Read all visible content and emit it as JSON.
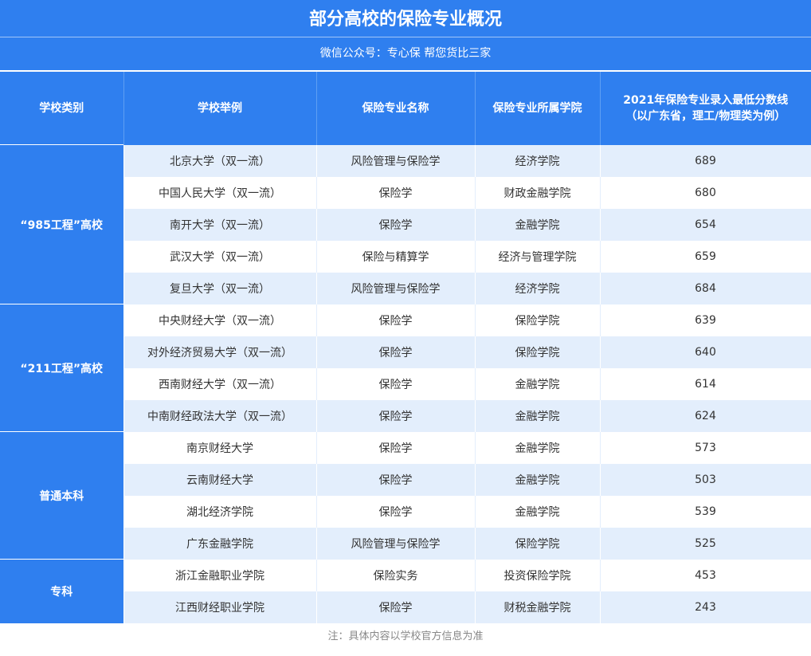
{
  "header": {
    "title": "部分高校的保险专业概况",
    "subtitle": "微信公众号：专心保 帮您货比三家"
  },
  "columns": [
    "学校类别",
    "学校举例",
    "保险专业名称",
    "保险专业所属学院",
    "2021年保险专业录入最低分数线",
    "（以广东省，理工/物理类为例）"
  ],
  "groups": [
    {
      "category": "“985工程”高校",
      "rows": [
        [
          "北京大学（双一流）",
          "风险管理与保险学",
          "经济学院",
          "689"
        ],
        [
          "中国人民大学（双一流）",
          "保险学",
          "财政金融学院",
          "680"
        ],
        [
          "南开大学（双一流）",
          "保险学",
          "金融学院",
          "654"
        ],
        [
          "武汉大学（双一流）",
          "保险与精算学",
          "经济与管理学院",
          "659"
        ],
        [
          "复旦大学（双一流）",
          "风险管理与保险学",
          "经济学院",
          "684"
        ]
      ]
    },
    {
      "category": "“211工程”高校",
      "rows": [
        [
          "中央财经大学（双一流）",
          "保险学",
          "保险学院",
          "639"
        ],
        [
          "对外经济贸易大学（双一流）",
          "保险学",
          "保险学院",
          "640"
        ],
        [
          "西南财经大学（双一流）",
          "保险学",
          "金融学院",
          "614"
        ],
        [
          "中南财经政法大学（双一流）",
          "保险学",
          "金融学院",
          "624"
        ]
      ]
    },
    {
      "category": "普通本科",
      "rows": [
        [
          "南京财经大学",
          "保险学",
          "金融学院",
          "573"
        ],
        [
          "云南财经大学",
          "保险学",
          "金融学院",
          "503"
        ],
        [
          "湖北经济学院",
          "保险学",
          "金融学院",
          "539"
        ],
        [
          "广东金融学院",
          "风险管理与保险学",
          "保险学院",
          "525"
        ]
      ]
    },
    {
      "category": "专科",
      "rows": [
        [
          "浙江金融职业学院",
          "保险实务",
          "投资保险学院",
          "453"
        ],
        [
          "江西财经职业学院",
          "保险学",
          "财税金融学院",
          "243"
        ]
      ]
    }
  ],
  "footer": {
    "note": "注：具体内容以学校官方信息为准"
  }
}
